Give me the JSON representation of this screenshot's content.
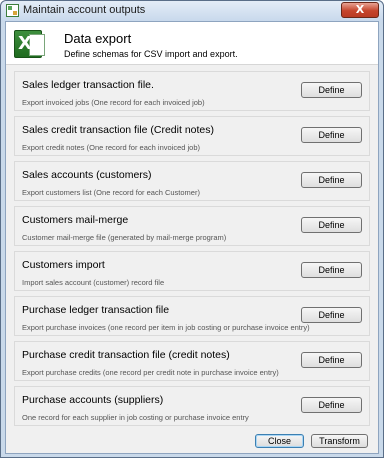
{
  "window": {
    "title": "Maintain account outputs",
    "close_glyph": "X"
  },
  "header": {
    "title": "Data export",
    "subtitle": "Define schemas for CSV import and export.",
    "icon": "excel-icon"
  },
  "sections": [
    {
      "title": "Sales ledger transaction file.",
      "description": "Export invoiced jobs (One record for each invoiced job)",
      "button": "Define"
    },
    {
      "title": "Sales credit transaction file (Credit notes)",
      "description": "Export credit notes (One record for each invoiced job)",
      "button": "Define"
    },
    {
      "title": "Sales accounts (customers)",
      "description": "Export customers list (One record for each Customer)",
      "button": "Define"
    },
    {
      "title": "Customers mail-merge",
      "description": "Customer mail-merge file (generated by mail-merge program)",
      "button": "Define"
    },
    {
      "title": "Customers import",
      "description": "Import sales account (customer) record file",
      "button": "Define"
    },
    {
      "title": "Purchase ledger transaction file",
      "description": "Export purchase invoices (one record per item in job costing or purchase invoice entry)",
      "button": "Define"
    },
    {
      "title": "Purchase credit transaction file (credit notes)",
      "description": "Export purchase credits (one record per credit note in purchase invoice entry)",
      "button": "Define"
    },
    {
      "title": "Purchase accounts (suppliers)",
      "description": "One record for each supplier in job costing or purchase invoice entry",
      "button": "Define"
    }
  ],
  "footer": {
    "close_label": "Close",
    "transform_label": "Transform"
  }
}
